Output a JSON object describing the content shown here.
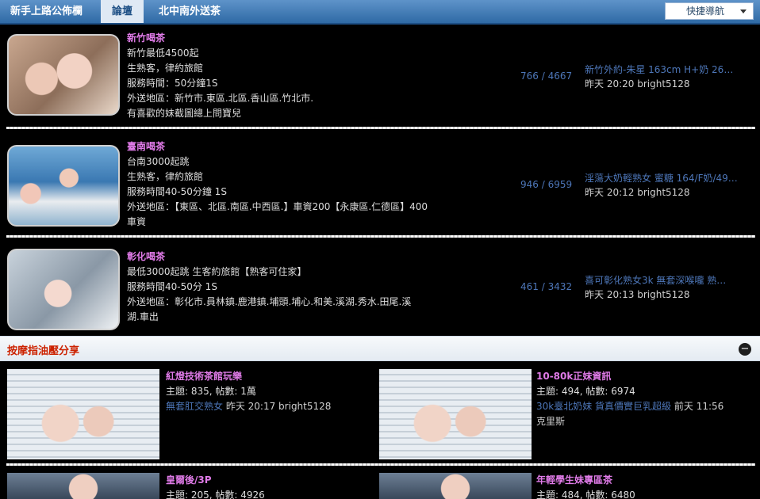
{
  "topnav": {
    "tabs": [
      "新手上路公佈欄",
      "論壇",
      "北中南外送茶"
    ],
    "quick_nav": "快捷導航"
  },
  "forums": [
    {
      "name": "新竹喝茶",
      "lines": [
        "新竹最低4500起",
        "生熟客，律約旅館",
        "服務時間：50分鐘1S",
        "外送地區：新竹市.東區.北區.香山區.竹北市.",
        "有喜歡的妹截圖總上問寶兒"
      ],
      "stats": "766 / 4667",
      "last_title": "新竹外約-朱星 163cm H+奶 26…",
      "last_meta": "昨天 20:20 bright5128"
    },
    {
      "name": "臺南喝茶",
      "lines": [
        "台南3000起跳",
        "生熟客，律約旅館",
        "服務時間40-50分鐘 1S",
        "外送地區：【東區、北區.南區.中西區.】車資200【永康區.仁德區】400",
        "車資"
      ],
      "stats": "946 / 6959",
      "last_title": "淫蕩大奶輕熟女 蜜糖 164/F奶/49…",
      "last_meta": "昨天 20:12 bright5128"
    },
    {
      "name": "彰化喝茶",
      "lines": [
        "最低3000起跳 生客約旅館【熟客可住家】",
        "服務時間40-50分 1S",
        "外送地區：彰化市.員林鎮.鹿港鎮.埔頭.埔心.和美.溪湖.秀水.田尾.溪",
        "湖.車出"
      ],
      "stats": "461 / 3432",
      "last_title": "喜可彰化熟女3k 無套深喉嚨 熟…",
      "last_meta": "昨天 20:13 bright5128"
    }
  ],
  "category": {
    "title": "按摩指油壓分享",
    "collapse_icon": "−"
  },
  "grid": [
    {
      "name": "紅燈技術茶館玩樂",
      "counts": "主題: 835, 帖數: 1萬",
      "last": "無套肛交熟女",
      "meta": "昨天 20:17 bright5128"
    },
    {
      "name": "10-80k正妹資訊",
      "counts": "主題: 494, 帖數: 6974",
      "last": "30k臺北奶妹 貨真價實巨乳超級",
      "meta": "前天 11:56 克里斯"
    },
    {
      "name": "皇爾後/3P",
      "counts": "主題: 205, 帖數: 4926",
      "last": "",
      "meta": ""
    },
    {
      "name": "年輕學生妹專區茶",
      "counts": "主題: 484, 帖數: 6480",
      "last": "",
      "meta": ""
    }
  ]
}
